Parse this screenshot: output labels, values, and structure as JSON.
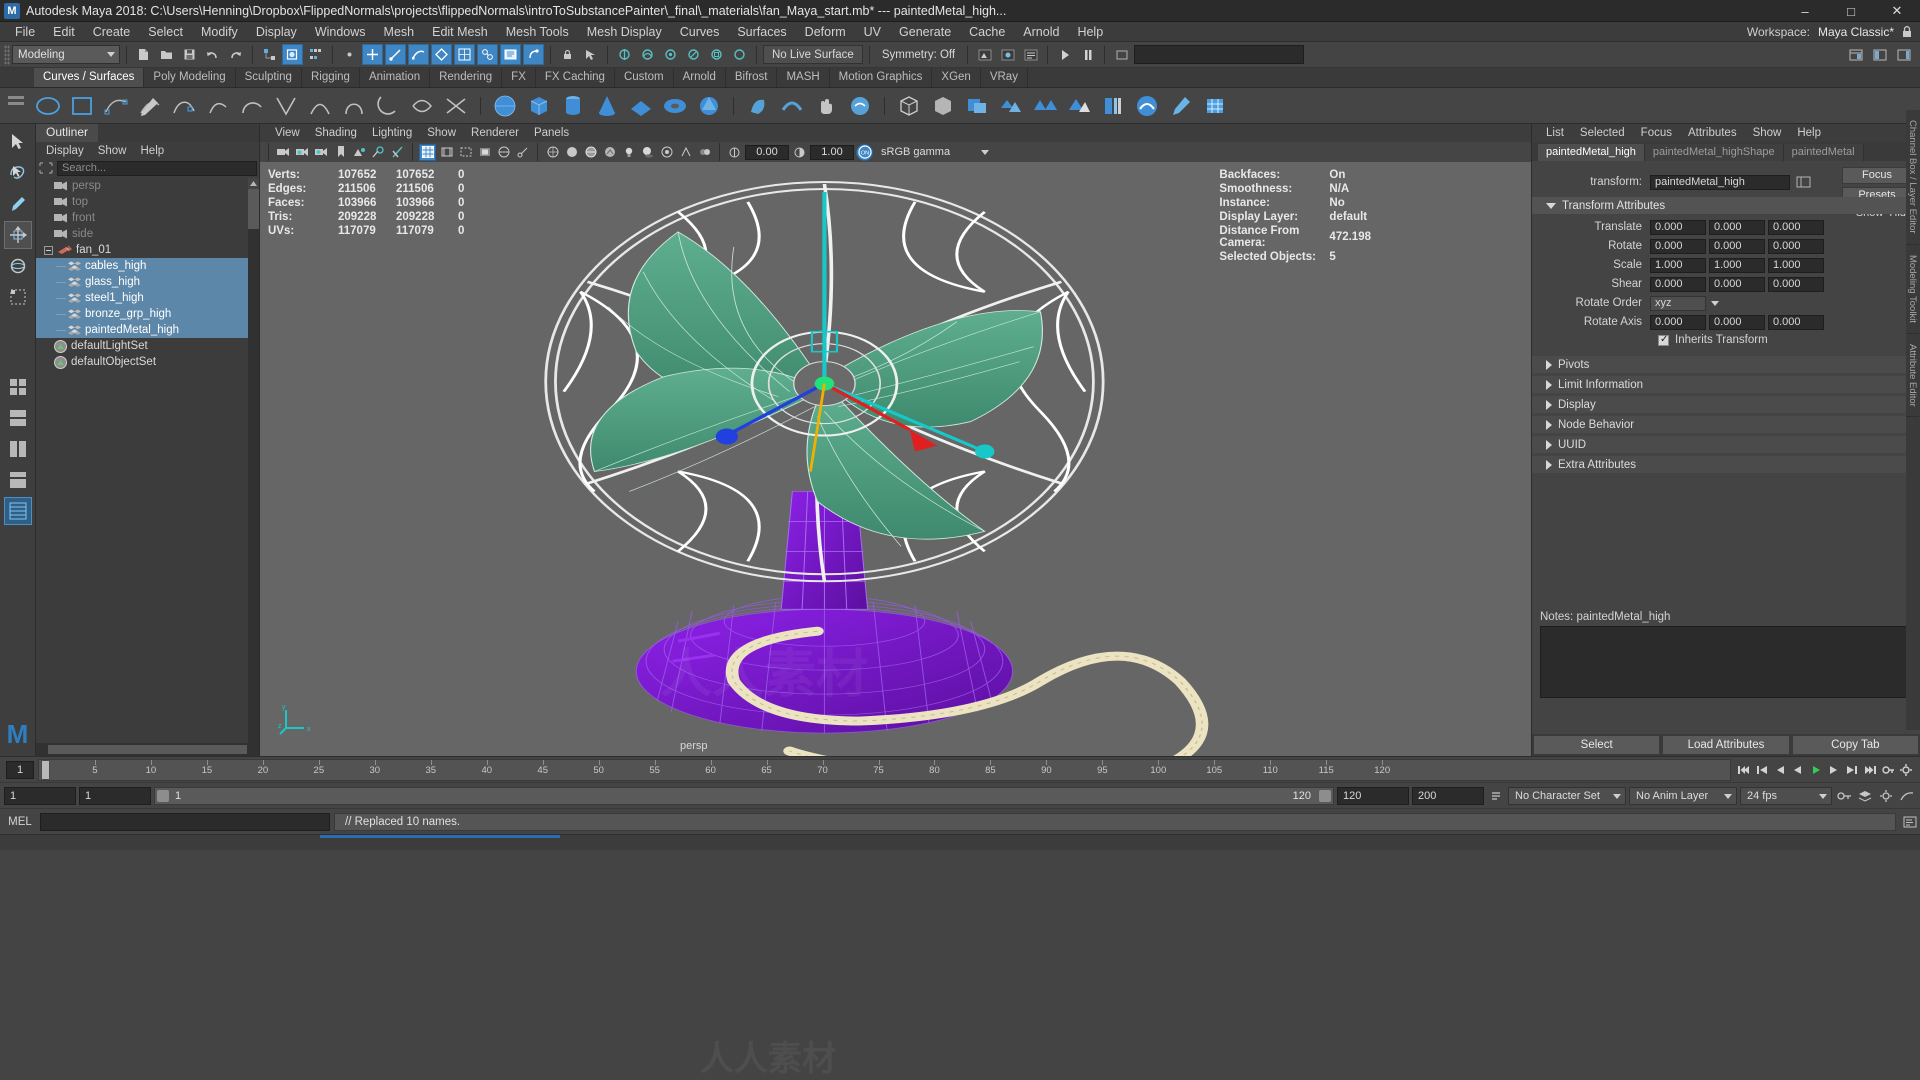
{
  "titlebar": {
    "logo": "M",
    "title": "Autodesk Maya 2018: C:\\Users\\Henning\\Dropbox\\FlippedNormals\\projects\\flippedNormals\\introToSubstancePainter\\_final\\_materials\\fan_Maya_start.mb*   ---   paintedMetal_high...",
    "minimize": "–",
    "maximize": "□",
    "close": "✕"
  },
  "menubar": {
    "items": [
      "File",
      "Edit",
      "Create",
      "Select",
      "Modify",
      "Display",
      "Windows",
      "Mesh",
      "Edit Mesh",
      "Mesh Tools",
      "Mesh Display",
      "Curves",
      "Surfaces",
      "Deform",
      "UV",
      "Generate",
      "Cache",
      "Arnold",
      "Help"
    ],
    "workspace_label": "Workspace:",
    "workspace_value": "Maya Classic*"
  },
  "statusline": {
    "mode": "Modeling",
    "no_live_surface": "No Live Surface",
    "symmetry": "Symmetry: Off"
  },
  "shelf": {
    "tabs": [
      "Curves / Surfaces",
      "Poly Modeling",
      "Sculpting",
      "Rigging",
      "Animation",
      "Rendering",
      "FX",
      "FX Caching",
      "Custom",
      "Arnold",
      "Bifrost",
      "MASH",
      "Motion Graphics",
      "XGen",
      "VRay"
    ],
    "active_tab": "Curves / Surfaces"
  },
  "outliner": {
    "tab_label": "Outliner",
    "menus": [
      "Display",
      "Show",
      "Help"
    ],
    "search_placeholder": "Search...",
    "items": [
      {
        "label": "persp",
        "type": "camera",
        "depth": 1,
        "selected": false,
        "dim": true
      },
      {
        "label": "top",
        "type": "camera",
        "depth": 1,
        "selected": false,
        "dim": true
      },
      {
        "label": "front",
        "type": "camera",
        "depth": 1,
        "selected": false,
        "dim": true
      },
      {
        "label": "side",
        "type": "camera",
        "depth": 1,
        "selected": false,
        "dim": true
      },
      {
        "label": "fan_01",
        "type": "group",
        "depth": 1,
        "selected": false,
        "dim": false
      },
      {
        "label": "cables_high",
        "type": "mesh",
        "depth": 2,
        "selected": true,
        "dim": false
      },
      {
        "label": "glass_high",
        "type": "mesh",
        "depth": 2,
        "selected": true,
        "dim": false
      },
      {
        "label": "steel1_high",
        "type": "mesh",
        "depth": 2,
        "selected": true,
        "dim": false
      },
      {
        "label": "bronze_grp_high",
        "type": "mesh",
        "depth": 2,
        "selected": true,
        "dim": false
      },
      {
        "label": "paintedMetal_high",
        "type": "mesh",
        "depth": 2,
        "selected": true,
        "dim": false
      },
      {
        "label": "defaultLightSet",
        "type": "set",
        "depth": 1,
        "selected": false,
        "dim": false
      },
      {
        "label": "defaultObjectSet",
        "type": "set",
        "depth": 1,
        "selected": false,
        "dim": false
      }
    ]
  },
  "viewport": {
    "menus": [
      "View",
      "Shading",
      "Lighting",
      "Show",
      "Renderer",
      "Panels"
    ],
    "exposure": "0.00",
    "gamma": "1.00",
    "color_mgmt": "sRGB gamma",
    "color_mgmt_toggle": "ON",
    "hud_left": {
      "rows": [
        {
          "label": "Verts:",
          "c1": "107652",
          "c2": "107652",
          "c3": "0"
        },
        {
          "label": "Edges:",
          "c1": "211506",
          "c2": "211506",
          "c3": "0"
        },
        {
          "label": "Faces:",
          "c1": "103966",
          "c2": "103966",
          "c3": "0"
        },
        {
          "label": "Tris:",
          "c1": "209228",
          "c2": "209228",
          "c3": "0"
        },
        {
          "label": "UVs:",
          "c1": "117079",
          "c2": "117079",
          "c3": "0"
        }
      ]
    },
    "hud_right": {
      "rows": [
        {
          "label": "Backfaces:",
          "value": "On"
        },
        {
          "label": "Smoothness:",
          "value": "N/A"
        },
        {
          "label": "Instance:",
          "value": "No"
        },
        {
          "label": "Display Layer:",
          "value": "default"
        },
        {
          "label": "Distance From Camera:",
          "value": "472.198"
        },
        {
          "label": "Selected Objects:",
          "value": "5"
        }
      ]
    },
    "axis_labels": {
      "x": "x",
      "y": "y",
      "z": "z"
    },
    "persp_label": "persp"
  },
  "attribute_editor": {
    "menus": [
      "List",
      "Selected",
      "Focus",
      "Attributes",
      "Show",
      "Help"
    ],
    "tabs": [
      "paintedMetal_high",
      "paintedMetal_highShape",
      "paintedMetal"
    ],
    "active_tab": "paintedMetal_high",
    "transform_label": "transform:",
    "transform_value": "paintedMetal_high",
    "focus_button": "Focus",
    "presets_button": "Presets",
    "show_label": "Show",
    "hide_label": "Hide",
    "section_transform": "Transform Attributes",
    "attributes": [
      {
        "label": "Translate",
        "v1": "0.000",
        "v2": "0.000",
        "v3": "0.000"
      },
      {
        "label": "Rotate",
        "v1": "0.000",
        "v2": "0.000",
        "v3": "0.000"
      },
      {
        "label": "Scale",
        "v1": "1.000",
        "v2": "1.000",
        "v3": "1.000"
      },
      {
        "label": "Shear",
        "v1": "0.000",
        "v2": "0.000",
        "v3": "0.000"
      }
    ],
    "rotate_order_label": "Rotate Order",
    "rotate_order_value": "xyz",
    "rotate_axis_label": "Rotate Axis",
    "rotate_axis": {
      "v1": "0.000",
      "v2": "0.000",
      "v3": "0.000"
    },
    "inherits_transform": "Inherits Transform",
    "collapsed_sections": [
      "Pivots",
      "Limit Information",
      "Display",
      "Node Behavior",
      "UUID",
      "Extra Attributes"
    ],
    "notes_label": "Notes:",
    "notes_value": "paintedMetal_high",
    "footer_buttons": [
      "Select",
      "Load Attributes",
      "Copy Tab"
    ]
  },
  "timeslider": {
    "current_frame": "1",
    "ticks": [
      "5",
      "10",
      "15",
      "20",
      "25",
      "30",
      "35",
      "40",
      "45",
      "50",
      "55",
      "60",
      "65",
      "70",
      "75",
      "80",
      "85",
      "90",
      "95",
      "100",
      "105",
      "110",
      "115",
      "120"
    ]
  },
  "rangeslider": {
    "start": "1",
    "start2": "1",
    "range_left": "1",
    "range_right": "120",
    "end": "120",
    "end2": "200",
    "character_set": "No Character Set",
    "anim_layer": "No Anim Layer",
    "fps": "24 fps"
  },
  "commandline": {
    "mel_label": "MEL",
    "input_value": "",
    "response": "// Replaced 10 names."
  },
  "right_tabs": [
    "Channel Box / Layer Editor",
    "Modeling Toolkit",
    "Attribute Editor"
  ],
  "colors": {
    "accent_blue": "#3e86c4",
    "selection_blue": "#5d87a8",
    "panel_bg": "#3a3a3a",
    "viewport_bg": "#666666",
    "mesh_green": "#57a586",
    "mesh_purple": "#7a19d6"
  }
}
